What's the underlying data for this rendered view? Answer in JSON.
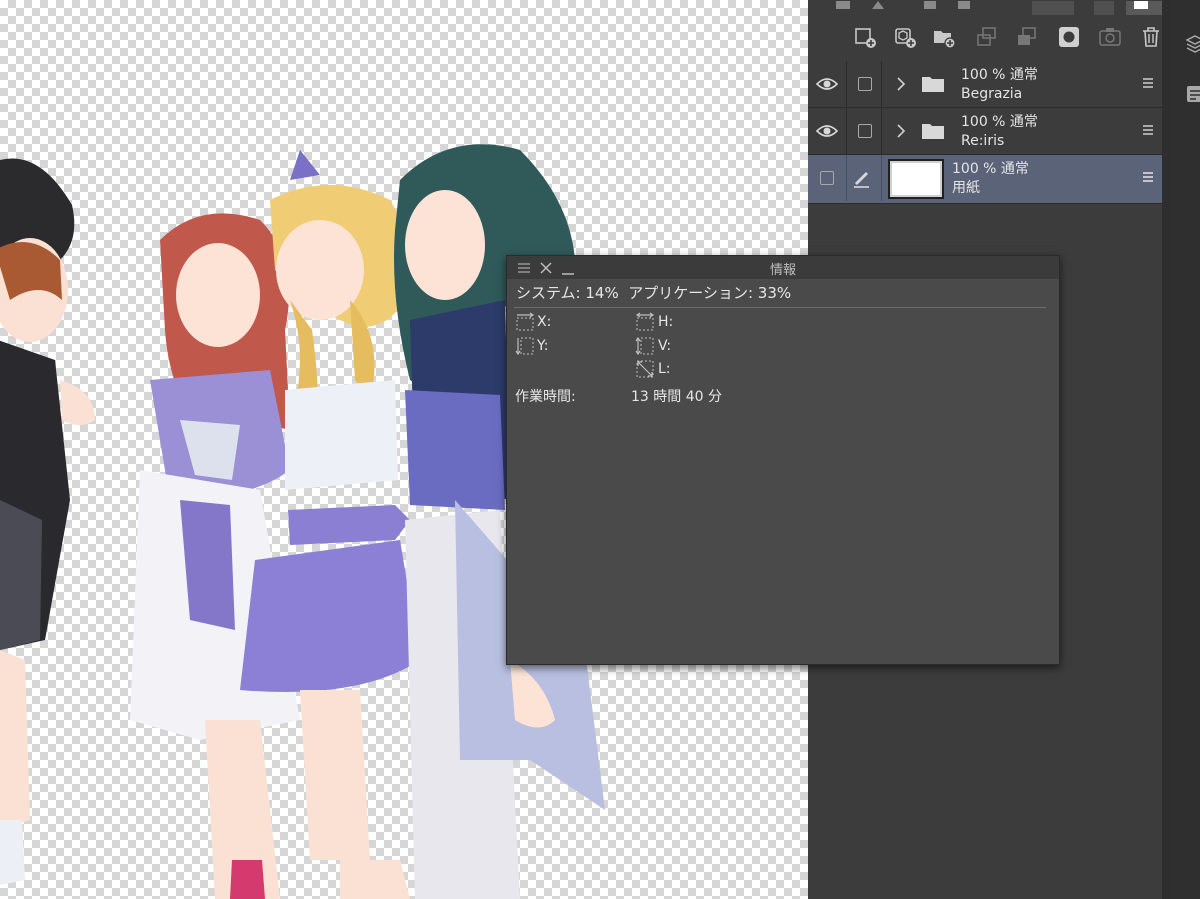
{
  "layers": [
    {
      "opacity_mode": "100 % 通常",
      "name": "Begrazia",
      "visible": true,
      "type": "folder",
      "selected": false
    },
    {
      "opacity_mode": "100 % 通常",
      "name": "Re:iris",
      "visible": true,
      "type": "folder",
      "selected": false
    },
    {
      "opacity_mode": "100 % 通常",
      "name": "用紙",
      "visible": false,
      "type": "paper",
      "selected": true
    }
  ],
  "info_palette": {
    "title": "情報",
    "system_usage": "システム: 14%",
    "app_usage": "アプリケーション: 33%",
    "x_label": "X:",
    "y_label": "Y:",
    "h_label": "H:",
    "v_label": "V:",
    "l_label": "L:",
    "work_time_label": "作業時間:",
    "work_time_value": "13 時間 40 分"
  },
  "colors": {
    "panel_bg": "#3c3c3c",
    "selected_layer": "#5b6379",
    "info_bg": "#4a4a4a",
    "checker": "#d6d6d6"
  },
  "icons": [
    "new-raster-layer-icon",
    "new-vector-layer-icon",
    "new-folder-icon",
    "transfer-down-icon",
    "combine-down-icon",
    "layer-mask-icon",
    "mask-camera-icon",
    "trash-icon",
    "eye-icon",
    "folder-icon",
    "pen-icon"
  ]
}
